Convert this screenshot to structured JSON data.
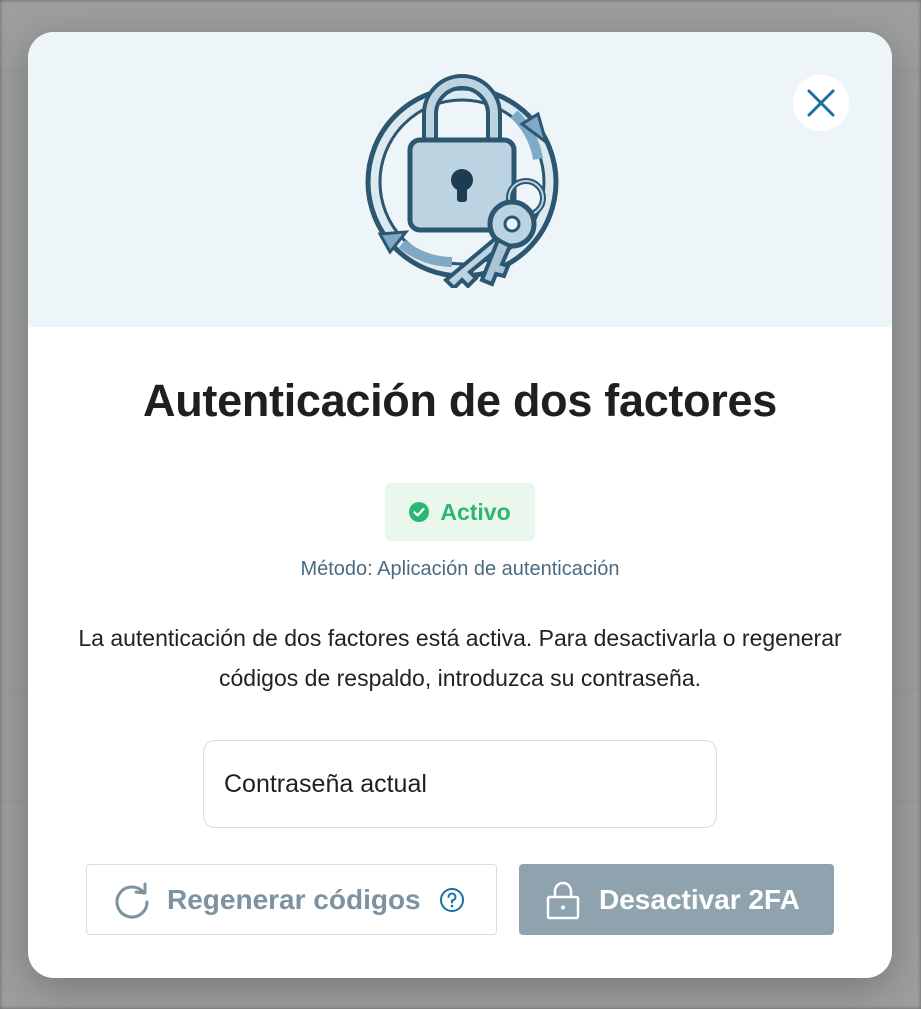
{
  "modal": {
    "title": "Autenticación de dos factores",
    "status": {
      "label": "Activo",
      "color": "#2bb673",
      "icon": "check-circle-icon"
    },
    "method": "Método: Aplicación de autenticación",
    "description": "La autenticación de dos factores está activa. Para desactivarla o regenerar códigos de respaldo, introduzca su contraseña.",
    "password_field": {
      "placeholder": "Contraseña actual",
      "value": ""
    },
    "regenerate_button": {
      "label": "Regenerar códigos",
      "icon": "refresh-icon",
      "help_icon": "help-circle-icon"
    },
    "disable_button": {
      "label": "Desactivar 2FA",
      "icon": "lock-icon",
      "color": "#8ea3ae"
    },
    "close_icon": "close-icon",
    "illustration": "padlock-keys-illustration"
  }
}
